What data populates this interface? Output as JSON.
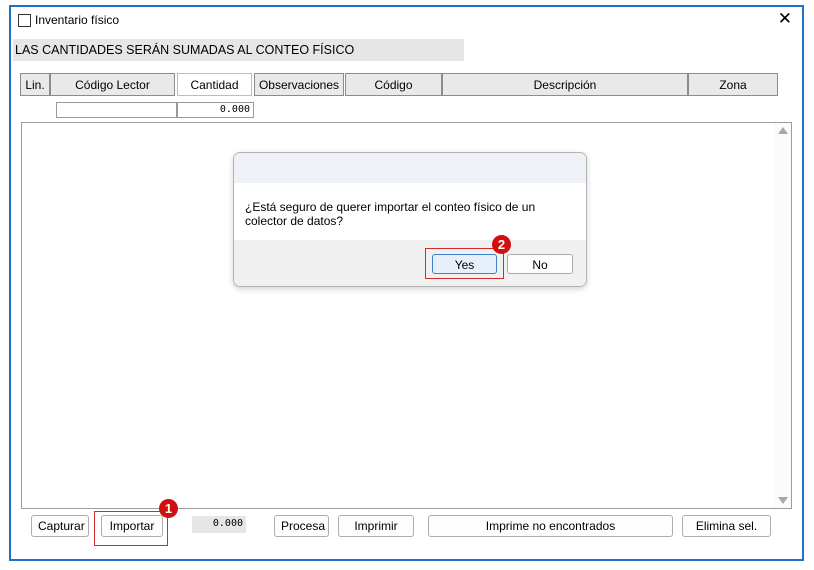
{
  "window": {
    "title": "Inventario físico",
    "close_glyph": "✕"
  },
  "banner": "LAS CANTIDADES SERÁN SUMADAS AL CONTEO FÍSICO",
  "grid": {
    "columns": [
      "Lin.",
      "Código Lector",
      "Cantidad",
      "Observaciones",
      "Código",
      "Descripción",
      "Zona"
    ],
    "filter_quantity": "0.000"
  },
  "dialog": {
    "message": "¿Está seguro de querer importar el conteo físico de un colector de datos?",
    "yes_label": "Yes",
    "no_label": "No"
  },
  "toolbar": {
    "capturar": "Capturar",
    "importar": "Importar",
    "counter": "0.000",
    "procesa": "Procesa",
    "imprimir": "Imprimir",
    "imprime_no_encontrados": "Imprime no encontrados",
    "elimina_sel": "Elimina sel."
  },
  "annotations": {
    "marker_1": "1",
    "marker_2": "2",
    "color": "#d10f0f"
  }
}
